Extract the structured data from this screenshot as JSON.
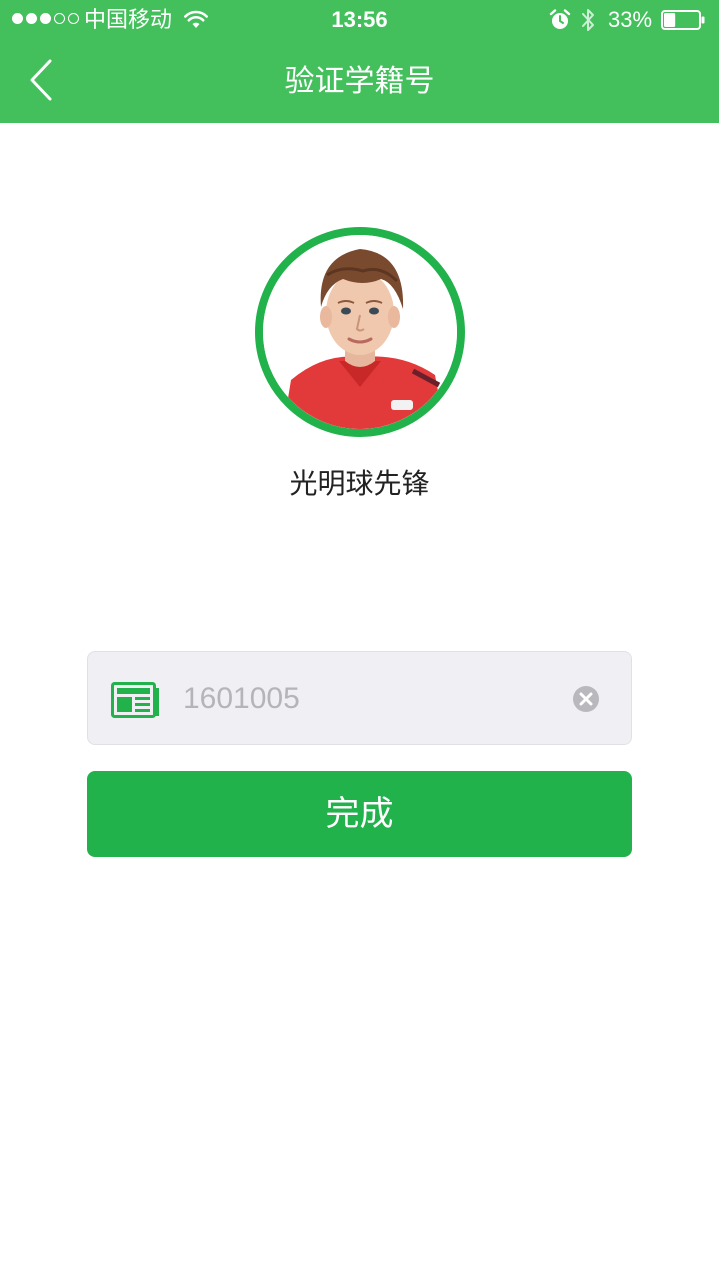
{
  "status_bar": {
    "carrier": "中国移动",
    "time": "13:56",
    "battery_percent": "33%",
    "battery_level": 0.33,
    "signal_bars_filled": 3,
    "signal_bars_total": 5
  },
  "nav": {
    "title": "验证学籍号",
    "back_icon": "chevron-left-icon"
  },
  "profile": {
    "name": "光明球先锋"
  },
  "form": {
    "student_id_value": "1601005",
    "field_icon": "id-card-icon",
    "clear_icon": "clear-icon",
    "submit_label": "完成"
  },
  "colors": {
    "header_green": "#43c05c",
    "accent_green": "#22b24b",
    "input_bg": "#efeff4"
  }
}
